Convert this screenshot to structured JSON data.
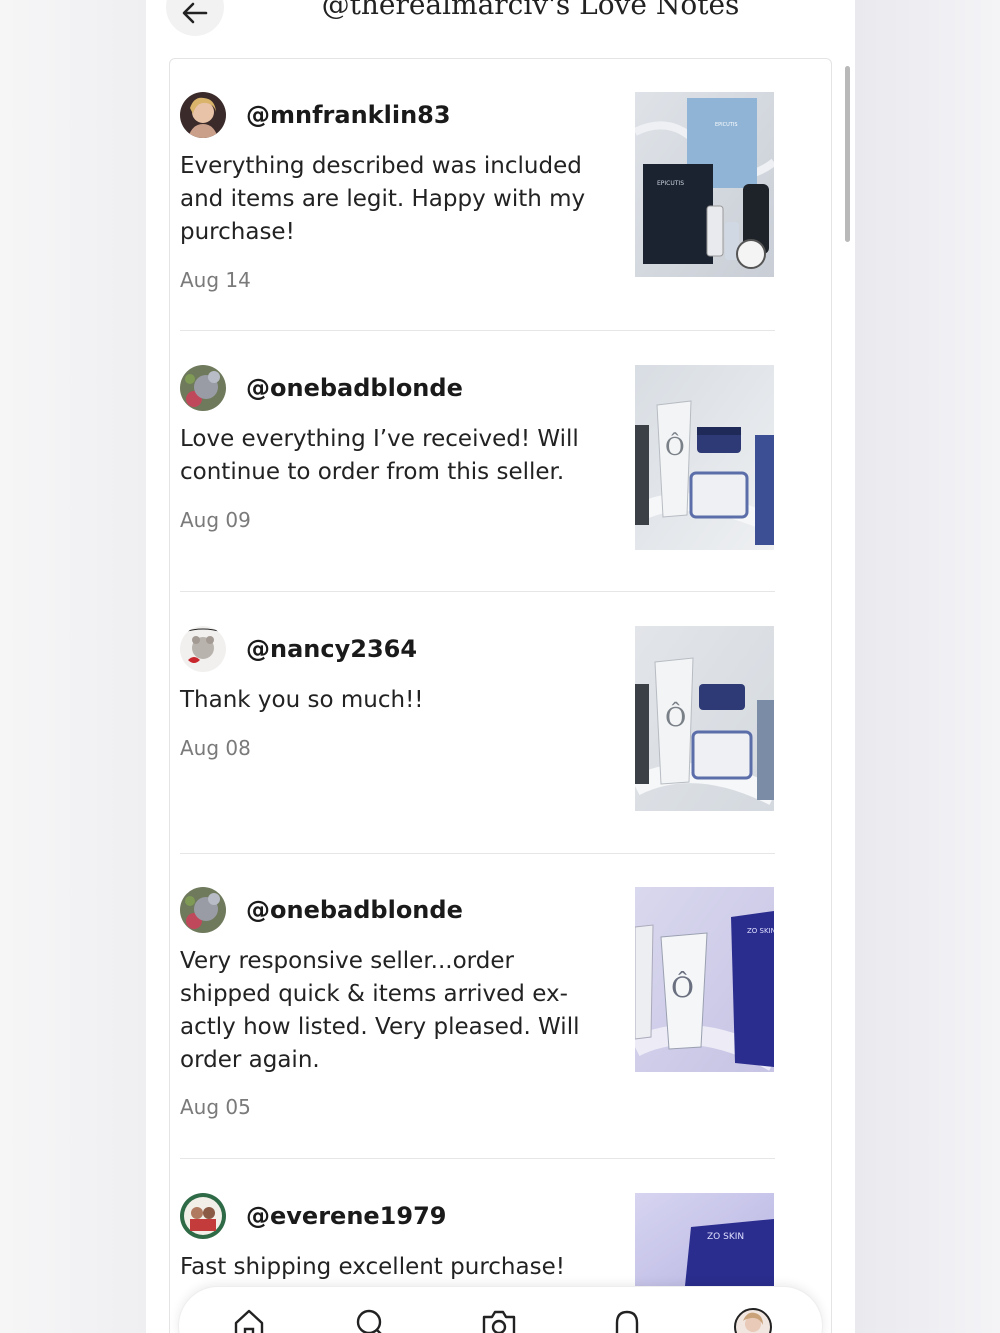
{
  "header": {
    "title": "@therealmarciv's Love Notes"
  },
  "reviews": [
    {
      "username": "@mnfranklin83",
      "text": "Everything described was included and items are legit. Happy with my purchase!",
      "date": "Aug 14",
      "image": "skincare-product-photo-epicutis"
    },
    {
      "username": "@onebadblonde",
      "text": "Love everything I’ve received! Will continue to order from this seller.",
      "date": "Aug 09",
      "image": "skincare-product-photo-zo-set"
    },
    {
      "username": "@nancy2364",
      "text": "Thank you so much!!",
      "date": "Aug 08",
      "image": "skincare-product-photo-zo-set"
    },
    {
      "username": "@onebadblonde",
      "text": "Very responsive seller...order shipped quick & items arrived ex-actly how listed. Very pleased. Will order again.",
      "date": "Aug 05",
      "image": "skincare-product-photo-zo-tubes"
    },
    {
      "username": "@everene1979",
      "text": "Fast shipping excellent purchase!",
      "date": "",
      "image": "skincare-product-photo-zo-packet"
    }
  ],
  "nav": {
    "items": [
      "home-icon",
      "search-icon",
      "camera-icon",
      "bell-icon",
      "profile-avatar"
    ]
  },
  "colors": {
    "text": "#222222",
    "muted": "#7a7a7a",
    "divider": "#e6e6e6"
  }
}
